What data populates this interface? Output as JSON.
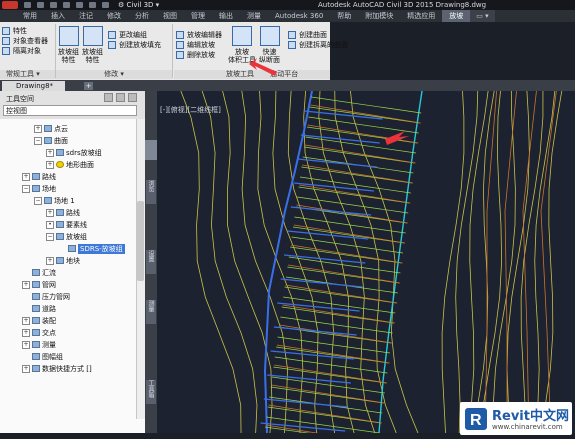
{
  "window": {
    "workspace": "Civil 3D",
    "title": "Autodesk AutoCAD Civil 3D 2015    Drawing8.dwg"
  },
  "tabs": [
    "常用",
    "插入",
    "注记",
    "修改",
    "分析",
    "视图",
    "管理",
    "输出",
    "测量",
    "Autodesk 360",
    "帮助",
    "附加模块",
    "精选应用",
    "放坡"
  ],
  "active_tab": "放坡",
  "ribbon": {
    "panel1": {
      "items": [
        "特性",
        "对象查看器",
        "隔离对象"
      ],
      "label": "常规工具 ▾"
    },
    "panel2": {
      "big": [
        {
          "label_line1": "放坡组",
          "label_line2": "特性"
        },
        {
          "label_line1": "放坡组",
          "label_line2": "特性"
        }
      ],
      "items": [
        "更改编组",
        "创建放坡填充"
      ],
      "label": "修改 ▾"
    },
    "panel3": {
      "items": [
        "放坡编辑器",
        "编辑放坡",
        "删除放坡"
      ]
    },
    "panel4": {
      "big": [
        {
          "label_line1": "放坡",
          "label_line2": "体积工具"
        },
        {
          "label_line1": "快速",
          "label_line2": "纵断面"
        }
      ],
      "items": [
        "创建曲面",
        "创建拆离的曲面"
      ],
      "labels": [
        "放坡工具",
        "启动平台"
      ]
    }
  },
  "doc_tab": "Drawing8*",
  "toolspace": {
    "title": "工具空间",
    "combo": "控视图",
    "tree": [
      {
        "label": "点云",
        "indent": 1,
        "exp": "+"
      },
      {
        "label": "曲面",
        "indent": 1,
        "exp": "−"
      },
      {
        "label": "sdrs放坡组",
        "indent": 2,
        "exp": "+"
      },
      {
        "label": "地形曲面",
        "indent": 2,
        "exp": "+",
        "warn": true
      },
      {
        "label": "路线",
        "indent": 0,
        "exp": "+"
      },
      {
        "label": "场地",
        "indent": 0,
        "exp": "−"
      },
      {
        "label": "场地 1",
        "indent": 1,
        "exp": "−"
      },
      {
        "label": "路线",
        "indent": 2,
        "exp": "+"
      },
      {
        "label": "要素线",
        "indent": 2,
        "exp": "•"
      },
      {
        "label": "放坡组",
        "indent": 2,
        "exp": "−"
      },
      {
        "label": "SDRS-放坡组",
        "indent": 3,
        "exp": "",
        "selected": true
      },
      {
        "label": "地块",
        "indent": 2,
        "exp": "+"
      },
      {
        "label": "汇流",
        "indent": 0,
        "exp": ""
      },
      {
        "label": "管网",
        "indent": 0,
        "exp": "+"
      },
      {
        "label": "压力管网",
        "indent": 0,
        "exp": ""
      },
      {
        "label": "道路",
        "indent": 0,
        "exp": ""
      },
      {
        "label": "装配",
        "indent": 0,
        "exp": "+"
      },
      {
        "label": "交点",
        "indent": 0,
        "exp": "+"
      },
      {
        "label": "测量",
        "indent": 0,
        "exp": "+"
      },
      {
        "label": "图幅组",
        "indent": 0,
        "exp": ""
      },
      {
        "label": "数据快捷方式 []",
        "indent": 0,
        "exp": "+"
      }
    ]
  },
  "sidebar": {
    "labels": [
      "浏览",
      "设置",
      "测量",
      "工具箱"
    ]
  },
  "viewport": "[-][俯视][二维线框]",
  "colors": {
    "canvas": "#1d2230",
    "yellow": "#c8c34a",
    "orange": "#c9752c",
    "blue": "#3a6fe8",
    "cyan": "#27c9d9",
    "arrow": "#e8343a"
  },
  "watermark": {
    "name": "Revit中文网",
    "url": "www.chinarevit.com"
  }
}
